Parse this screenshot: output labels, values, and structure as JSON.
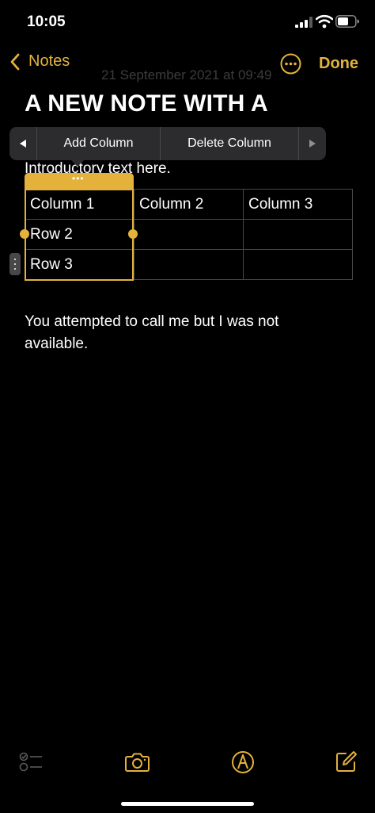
{
  "status_bar": {
    "time": "10:05"
  },
  "nav": {
    "back_label": "Notes",
    "done_label": "Done"
  },
  "note": {
    "date": "21 September 2021 at 09:49",
    "title": "A NEW NOTE WITH A",
    "intro": "Introductory text here.",
    "body": "You attempted to call me but I was not available."
  },
  "context_menu": {
    "items": [
      "Add Column",
      "Delete Column"
    ]
  },
  "table": {
    "rows": [
      [
        "Column 1",
        "Column 2",
        "Column 3"
      ],
      [
        "Row 2",
        "",
        ""
      ],
      [
        "Row 3",
        "",
        ""
      ]
    ]
  },
  "colors": {
    "accent": "#e4b23b",
    "background": "#000000",
    "menu_bg": "#2c2c2e"
  },
  "toolbar": {
    "icons": [
      "checklist-icon",
      "camera-icon",
      "markup-icon",
      "compose-icon"
    ]
  }
}
